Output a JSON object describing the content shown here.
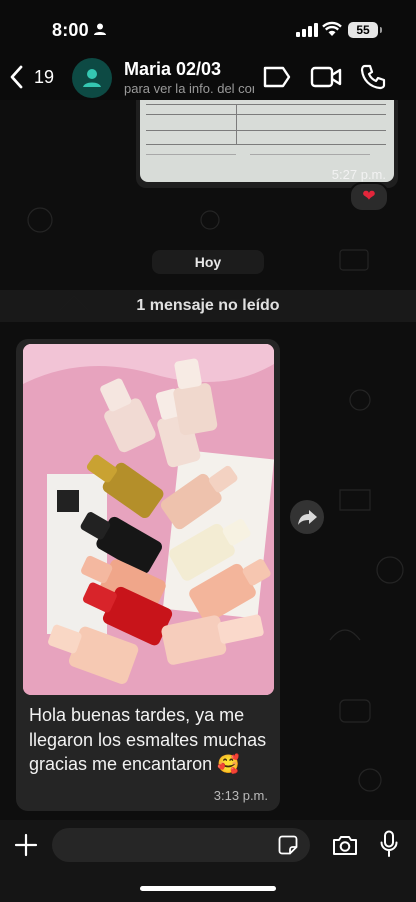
{
  "status": {
    "time": "8:00",
    "battery": "55"
  },
  "header": {
    "back_count": "19",
    "name": "Maria 02/03",
    "subtitle": "para ver la info. del contacto"
  },
  "prev_message": {
    "time": "5:27 p.m.",
    "reaction": "❤"
  },
  "date_chip": "Hoy",
  "unread": "1 mensaje no leído",
  "message": {
    "text": "Hola buenas tardes, ya me llegaron los esmaltes muchas gracias me encantaron 🥰",
    "time": "3:13 p.m."
  },
  "composer": {
    "placeholder": ""
  },
  "colors": {
    "accent": "#25d366",
    "bubble": "#252525",
    "background": "#0b0b0b"
  },
  "icons": [
    "back-icon",
    "avatar-person-icon",
    "label-icon",
    "video-call-icon",
    "voice-call-icon",
    "forward-icon",
    "plus-icon",
    "sticker-icon",
    "camera-icon",
    "mic-icon"
  ]
}
